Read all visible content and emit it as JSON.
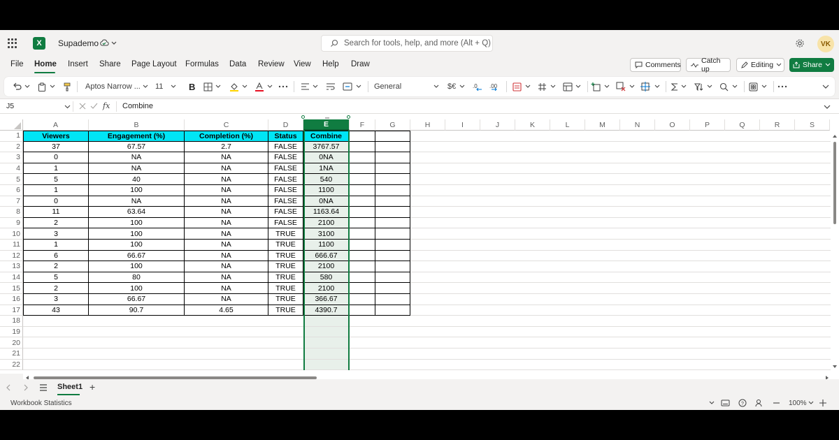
{
  "app": {
    "logo_letter": "X",
    "doc_title": "Supademo",
    "user_initials": "VK"
  },
  "search": {
    "placeholder": "Search for tools, help, and more (Alt + Q)"
  },
  "menu": {
    "items": [
      "File",
      "Home",
      "Insert",
      "Share",
      "Page Layout",
      "Formulas",
      "Data",
      "Review",
      "View",
      "Help",
      "Draw"
    ],
    "comments": "Comments",
    "catch_up": "Catch up",
    "editing": "Editing",
    "share": "Share"
  },
  "ribbon": {
    "font_name": "Aptos Narrow ...",
    "font_size": "11",
    "bold": "B",
    "number_format": "General",
    "currency": "$€"
  },
  "formula_bar": {
    "name_box": "J5",
    "fx": "fx",
    "value": "Combine"
  },
  "columns": [
    "A",
    "B",
    "C",
    "D",
    "E",
    "F",
    "G",
    "H",
    "I",
    "J",
    "K",
    "L",
    "M",
    "N",
    "O",
    "P",
    "Q",
    "R",
    "S"
  ],
  "selected_column": "E",
  "rows": [
    "1",
    "2",
    "3",
    "4",
    "5",
    "6",
    "7",
    "8",
    "9",
    "10",
    "11",
    "12",
    "13",
    "14",
    "15",
    "16",
    "17",
    "18",
    "19",
    "20",
    "21",
    "22"
  ],
  "table": {
    "headers": [
      "Viewers",
      "Engagement (%)",
      "Completion (%)",
      "Status",
      "Combine"
    ],
    "rows": [
      [
        "37",
        "67.57",
        "2.7",
        "FALSE",
        "3767.57"
      ],
      [
        "0",
        "NA",
        "NA",
        "FALSE",
        "0NA"
      ],
      [
        "1",
        "NA",
        "NA",
        "FALSE",
        "1NA"
      ],
      [
        "5",
        "40",
        "NA",
        "FALSE",
        "540"
      ],
      [
        "1",
        "100",
        "NA",
        "FALSE",
        "1100"
      ],
      [
        "0",
        "NA",
        "NA",
        "FALSE",
        "0NA"
      ],
      [
        "11",
        "63.64",
        "NA",
        "FALSE",
        "1163.64"
      ],
      [
        "2",
        "100",
        "NA",
        "FALSE",
        "2100"
      ],
      [
        "3",
        "100",
        "NA",
        "TRUE",
        "3100"
      ],
      [
        "1",
        "100",
        "NA",
        "TRUE",
        "1100"
      ],
      [
        "6",
        "66.67",
        "NA",
        "TRUE",
        "666.67"
      ],
      [
        "2",
        "100",
        "NA",
        "TRUE",
        "2100"
      ],
      [
        "5",
        "80",
        "NA",
        "TRUE",
        "580"
      ],
      [
        "2",
        "100",
        "NA",
        "TRUE",
        "2100"
      ],
      [
        "3",
        "66.67",
        "NA",
        "TRUE",
        "366.67"
      ],
      [
        "43",
        "90.7",
        "4.65",
        "TRUE",
        "4390.7"
      ]
    ]
  },
  "sheet_tabs": {
    "active": "Sheet1",
    "add": "+"
  },
  "status": {
    "left": "Workbook Statistics",
    "zoom": "100%"
  },
  "colors": {
    "accent": "#107c41",
    "header_fill": "#00e5f5"
  }
}
